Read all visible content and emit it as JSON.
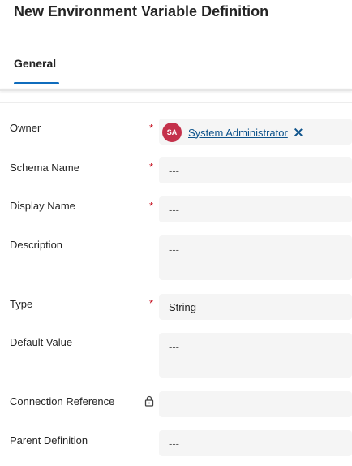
{
  "header": {
    "title": "New Environment Variable Definition",
    "tabs": [
      {
        "label": "General",
        "selected": true
      }
    ]
  },
  "colors": {
    "accent": "#0f6cbd",
    "required": "#c50f1f",
    "avatar_bg": "#c4314b",
    "link": "#0f548c",
    "field_bg": "#f5f5f5"
  },
  "form": {
    "owner": {
      "label": "Owner",
      "required_mark": "*",
      "avatar_initials": "SA",
      "value": "System Administrator",
      "remove_icon": "close-icon"
    },
    "schema_name": {
      "label": "Schema Name",
      "required_mark": "*",
      "value": "---"
    },
    "display_name": {
      "label": "Display Name",
      "required_mark": "*",
      "value": "---"
    },
    "description": {
      "label": "Description",
      "value": "---"
    },
    "type": {
      "label": "Type",
      "required_mark": "*",
      "value": "String"
    },
    "default_value": {
      "label": "Default Value",
      "value": "---"
    },
    "connection_reference": {
      "label": "Connection Reference",
      "locked_icon": "lock-icon",
      "value": ""
    },
    "parent_definition": {
      "label": "Parent Definition",
      "value": "---"
    }
  }
}
